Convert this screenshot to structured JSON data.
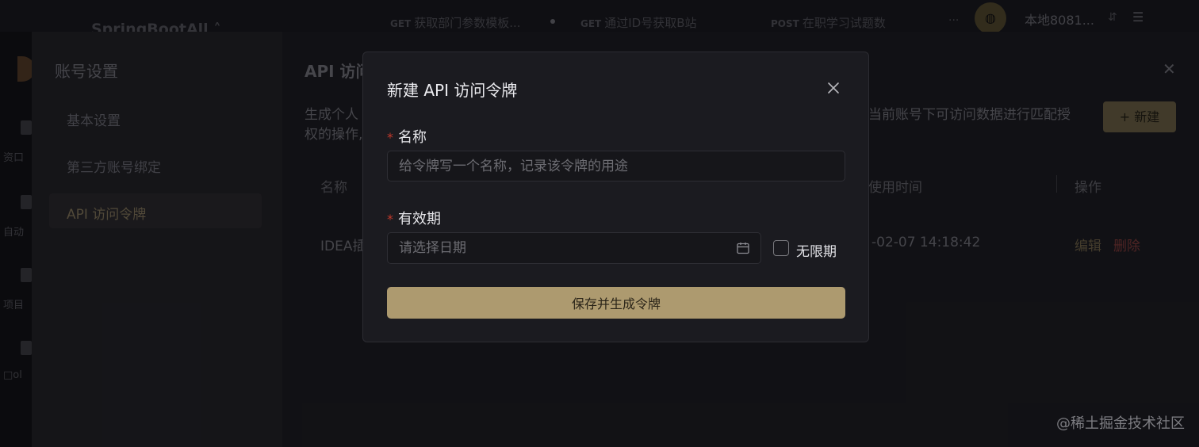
{
  "topbar": {
    "project": "SpringBootAll ˄",
    "tabs": [
      {
        "method": "GET",
        "label": "获取部门参数模板..."
      },
      {
        "method": "GET",
        "label": "通过ID号获取B站"
      },
      {
        "method": "POST",
        "label": "在职学习试题数"
      }
    ],
    "more": "···",
    "env_icon": "◍",
    "environment": "本地8081...",
    "env_caret": "⇵",
    "menu_icon": "☰"
  },
  "left_strip": {
    "items": [
      "资口",
      "自动",
      "项目",
      "□ol"
    ]
  },
  "settings": {
    "nav_title": "账号设置",
    "nav_items": [
      "基本设置",
      "第三方账号绑定",
      "API 访问令牌"
    ],
    "page_title": "API 访问",
    "desc_line1_left": "生成个人",
    "desc_line1_right": "当前账号下可访问数据进行匹配授",
    "desc_line2": "权的操作,",
    "new_button": "+ 新建",
    "table": {
      "headers": [
        "名称",
        "使用时间",
        "操作"
      ],
      "row": {
        "name": "IDEA插",
        "time": "-02-07 14:18:42",
        "edit": "编辑",
        "delete": "删除"
      }
    },
    "close": "✕"
  },
  "modal": {
    "title": "新建 API 访问令牌",
    "name_label": "名称",
    "name_placeholder": "给令牌写一个名称，记录该令牌的用途",
    "expiry_label": "有效期",
    "date_placeholder": "请选择日期",
    "unlimited_label": "无限期",
    "save_button": "保存并生成令牌",
    "required_mark": "*"
  },
  "watermark": "@稀土掘金技术社区",
  "colors": {
    "accent": "#ad9a6f",
    "danger": "#c0392b",
    "modal_bg": "#1b1b20"
  }
}
